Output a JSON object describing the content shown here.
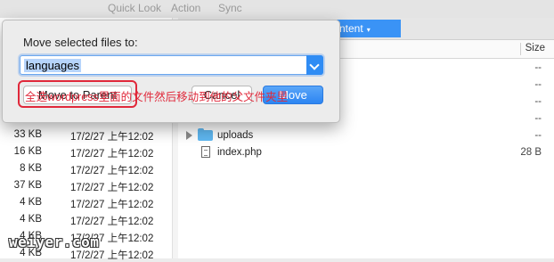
{
  "toolbar": {
    "items": [
      "Quick Look",
      "Action",
      "Sync"
    ]
  },
  "path": {
    "current_segment": "ntent"
  },
  "right_pane": {
    "size_header": "Size",
    "rows": [
      {
        "name": "",
        "size": "--"
      },
      {
        "name": "",
        "size": "--"
      },
      {
        "name": "",
        "size": "--"
      },
      {
        "name": "",
        "size": "--"
      },
      {
        "name": "uploads",
        "size": "--",
        "kind": "folder"
      },
      {
        "name": "index.php",
        "size": "28 B",
        "kind": "file"
      }
    ]
  },
  "left_pane": {
    "rows": [
      {
        "size": "33 KB",
        "date": "17/2/27 上午12:02"
      },
      {
        "size": "16 KB",
        "date": "17/2/27 上午12:02"
      },
      {
        "size": "8 KB",
        "date": "17/2/27 上午12:02"
      },
      {
        "size": "37 KB",
        "date": "17/2/27 上午12:02"
      },
      {
        "size": "4 KB",
        "date": "17/2/27 上午12:02"
      },
      {
        "size": "4 KB",
        "date": "17/2/27 上午12:02"
      },
      {
        "size": "4 KB",
        "date": "17/2/27 上午12:02"
      },
      {
        "size": "4 KB",
        "date": "17/2/27 上午12:02"
      }
    ]
  },
  "dialog": {
    "title": "Move selected files to:",
    "destination_value": "languages",
    "move_to_parent_label": "Move to Parent",
    "cancel_label": "Cancel",
    "move_label": "Move",
    "accent_color": "#2f8cf4"
  },
  "annotation": {
    "text": "全选wordpress里面的文件然后移动到他的父文件夹里",
    "color": "#e0283a"
  },
  "watermark": {
    "text": "weiyer.com"
  }
}
